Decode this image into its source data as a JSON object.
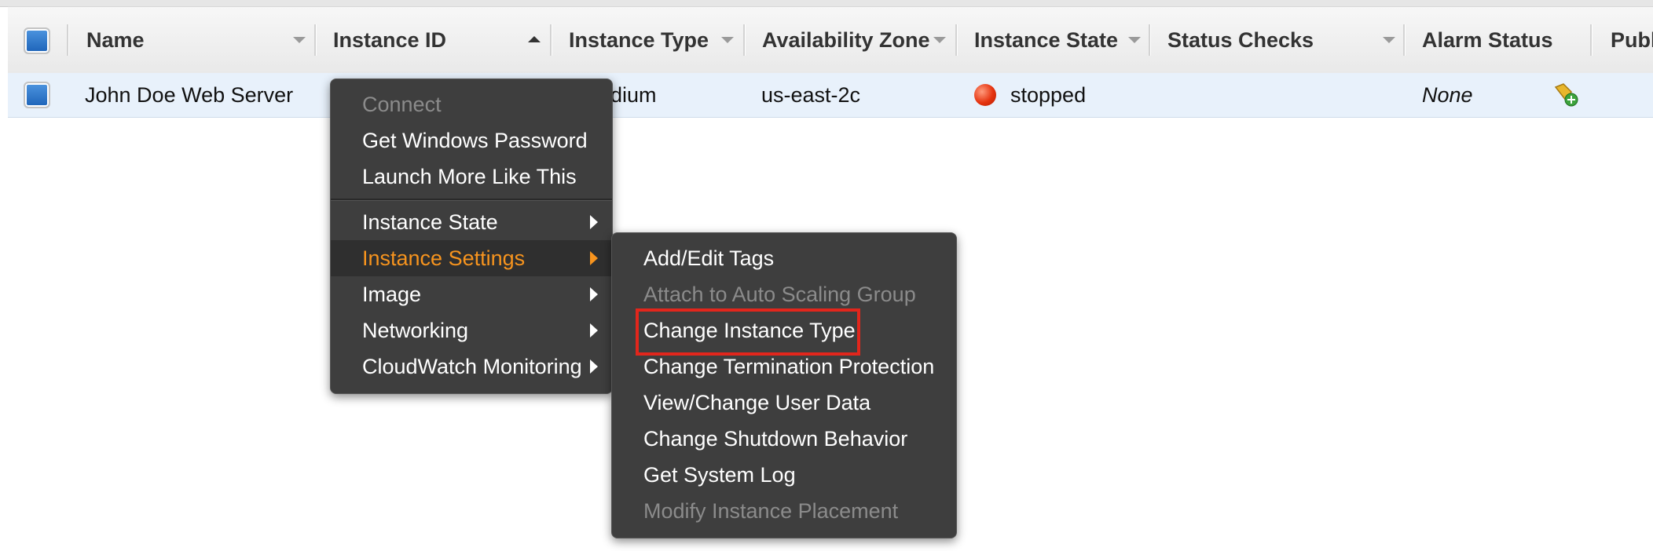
{
  "table": {
    "columns": [
      "Name",
      "Instance ID",
      "Instance Type",
      "Availability Zone",
      "Instance State",
      "Status Checks",
      "Alarm Status",
      "Publ"
    ],
    "row": {
      "name": "John Doe Web Server",
      "instance_type": "edium",
      "availability_zone": "us-east-2c",
      "instance_state": "stopped",
      "alarm_status": "None"
    }
  },
  "context_menu": {
    "items": [
      {
        "label": "Connect",
        "disabled": true
      },
      {
        "label": "Get Windows Password"
      },
      {
        "label": "Launch More Like This"
      },
      {
        "label": "Instance State",
        "submenu": true
      },
      {
        "label": "Instance Settings",
        "submenu": true,
        "active": true
      },
      {
        "label": "Image",
        "submenu": true
      },
      {
        "label": "Networking",
        "submenu": true
      },
      {
        "label": "CloudWatch Monitoring",
        "submenu": true
      }
    ]
  },
  "submenu": {
    "items": [
      {
        "label": "Add/Edit Tags"
      },
      {
        "label": "Attach to Auto Scaling Group",
        "disabled": true
      },
      {
        "label": "Change Instance Type",
        "highlighted": true
      },
      {
        "label": "Change Termination Protection"
      },
      {
        "label": "View/Change User Data"
      },
      {
        "label": "Change Shutdown Behavior"
      },
      {
        "label": "Get System Log"
      },
      {
        "label": "Modify Instance Placement",
        "disabled": true
      }
    ]
  },
  "colors": {
    "menu_bg": "#3e3e3e",
    "active_text": "#f7941e",
    "highlight_border": "#e2261c",
    "row_bg": "#e8f1fb"
  }
}
